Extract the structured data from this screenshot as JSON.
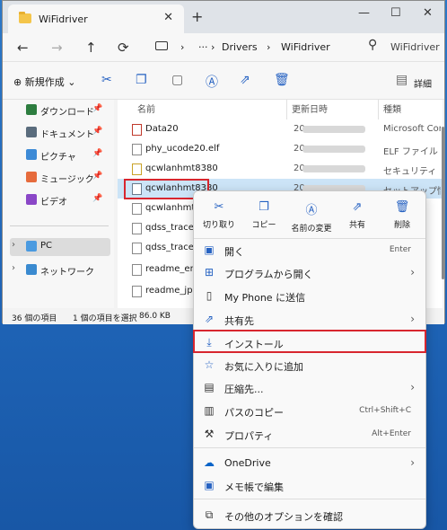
{
  "window": {
    "tab_title": "WiFidriver",
    "tab_close": "✕",
    "new_tab": "+",
    "min": "—",
    "max": "☐",
    "close": "✕"
  },
  "address": {
    "back": "←",
    "forward": "→",
    "up": "↑",
    "sep1": "›",
    "ellipsis": "···",
    "sep2": "›",
    "crumb1": "Drivers",
    "sep3": "›",
    "crumb2": "WiFidriver",
    "search_placeholder": "WiFidriver"
  },
  "toolbar": {
    "new_label": "新規作成",
    "details_label": "詳細"
  },
  "sidebar": {
    "items": [
      {
        "label": "ダウンロード",
        "pin": "📌",
        "color": "#2d7d3f"
      },
      {
        "label": "ドキュメント",
        "pin": "📌",
        "color": "#5a6c7d"
      },
      {
        "label": "ピクチャ",
        "pin": "📌",
        "color": "#3d8ad6"
      },
      {
        "label": "ミュージック",
        "pin": "📌",
        "color": "#e66b3c"
      },
      {
        "label": "ビデオ",
        "pin": "📌",
        "color": "#8a47c7"
      },
      {
        "label": "PC",
        "chev": "›"
      },
      {
        "label": "ネットワーク",
        "chev": "›"
      }
    ]
  },
  "files": {
    "columns": [
      "名前",
      "更新日時",
      "種類"
    ],
    "rows": [
      {
        "name": "Data20",
        "date": "20",
        "type": "Microsoft Com"
      },
      {
        "name": "phy_ucode20.elf",
        "date": "20",
        "type": "ELF ファイル"
      },
      {
        "name": "qcwlanhmt8380",
        "date": "20",
        "type": "セキュリティ カタ"
      },
      {
        "name": "qcwlanhmt8380",
        "date": "20",
        "type": "セットアップ情報"
      },
      {
        "name": "qcwlanhmt83",
        "date": "",
        "type": ""
      },
      {
        "name": "qdss_trace_co",
        "date": "",
        "type": ""
      },
      {
        "name": "qdss_trace_co",
        "date": "",
        "type": ""
      },
      {
        "name": "readme_en",
        "date": "",
        "type": ""
      },
      {
        "name": "readme_jp",
        "date": "",
        "type": ""
      }
    ]
  },
  "status": {
    "count": "36 個の項目",
    "selected": "1 個の項目を選択",
    "size": "86.0 KB"
  },
  "context_menu": {
    "quick_actions": [
      "切り取り",
      "コピー",
      "名前の変更",
      "共有",
      "削除"
    ],
    "items": [
      {
        "label": "開く",
        "shortcut": "Enter"
      },
      {
        "label": "プログラムから開く",
        "arrow": "›"
      },
      {
        "label": "My Phone に送信"
      },
      {
        "label": "共有先",
        "arrow": "›"
      },
      {
        "label": "インストール"
      },
      {
        "label": "お気に入りに追加"
      },
      {
        "label": "圧縮先...",
        "arrow": "›"
      },
      {
        "label": "パスのコピー",
        "shortcut": "Ctrl+Shift+C"
      },
      {
        "label": "プロパティ",
        "shortcut": "Alt+Enter"
      },
      {
        "label": "OneDrive",
        "arrow": "›"
      },
      {
        "label": "メモ帳で編集"
      },
      {
        "label": "その他のオプションを確認"
      }
    ]
  },
  "colors": {
    "accent": "#2662c2",
    "highlight_box": "#d8262f",
    "desktop": "#1d63b4"
  }
}
